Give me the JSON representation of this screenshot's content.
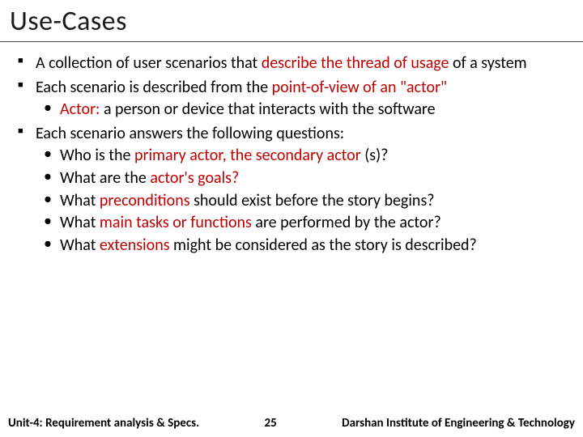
{
  "accent": "#c00000",
  "title": "Use-Cases",
  "footer": {
    "left": "Unit-4: Requirement analysis & Specs.",
    "page": "25",
    "right": "Darshan Institute of Engineering & Technology"
  },
  "bullets": [
    {
      "runs": [
        {
          "t": "A collection of user scenarios that "
        },
        {
          "t": "describe the thread of usage ",
          "hl": true
        },
        {
          "t": "of a system"
        }
      ]
    },
    {
      "runs": [
        {
          "t": "Each scenario is described from the "
        },
        {
          "t": "point-of-view of an \"actor\"",
          "hl": true
        }
      ],
      "sub": [
        {
          "runs": [
            {
              "t": "Actor: ",
              "hl": true
            },
            {
              "t": "a person or device "
            },
            {
              "t": "that interacts with the software"
            }
          ]
        }
      ]
    },
    {
      "runs": [
        {
          "t": "Each scenario answers the following questions:"
        }
      ],
      "sub": [
        {
          "runs": [
            {
              "t": "Who is the "
            },
            {
              "t": "primary actor, the secondary actor ",
              "hl": true
            },
            {
              "t": "(s)?"
            }
          ]
        },
        {
          "runs": [
            {
              "t": "What are the "
            },
            {
              "t": "actor's goals?",
              "hl": true
            }
          ]
        },
        {
          "runs": [
            {
              "t": "What "
            },
            {
              "t": "preconditions ",
              "hl": true
            },
            {
              "t": "should exist before the story begins?"
            }
          ]
        },
        {
          "runs": [
            {
              "t": "What "
            },
            {
              "t": "main tasks or functions ",
              "hl": true
            },
            {
              "t": "are performed by the actor?"
            }
          ]
        },
        {
          "runs": [
            {
              "t": "What "
            },
            {
              "t": "extensions ",
              "hl": true
            },
            {
              "t": "might be considered as the story is described?"
            }
          ]
        }
      ]
    }
  ]
}
